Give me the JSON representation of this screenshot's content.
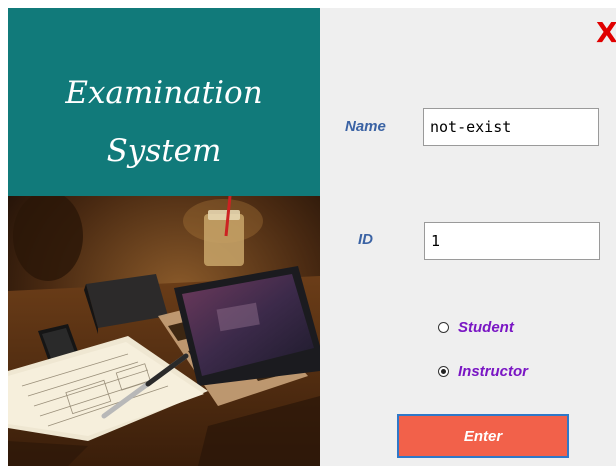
{
  "app": {
    "title_line1": "Examination",
    "title_line2": "System",
    "close_label": "X"
  },
  "form": {
    "name_label": "Name",
    "name_value": "not-exist",
    "id_label": "ID",
    "id_value": "1",
    "role_options": [
      {
        "label": "Student",
        "selected": false
      },
      {
        "label": "Instructor",
        "selected": true
      }
    ],
    "submit_label": "Enter"
  },
  "colors": {
    "banner": "#117a7a",
    "close": "#e00000",
    "field_label": "#3b63a4",
    "radio_label": "#7a16c4",
    "button": "#f2614a",
    "button_border": "#2f78c8"
  },
  "icons": {
    "photo": "study-desk-photo"
  }
}
